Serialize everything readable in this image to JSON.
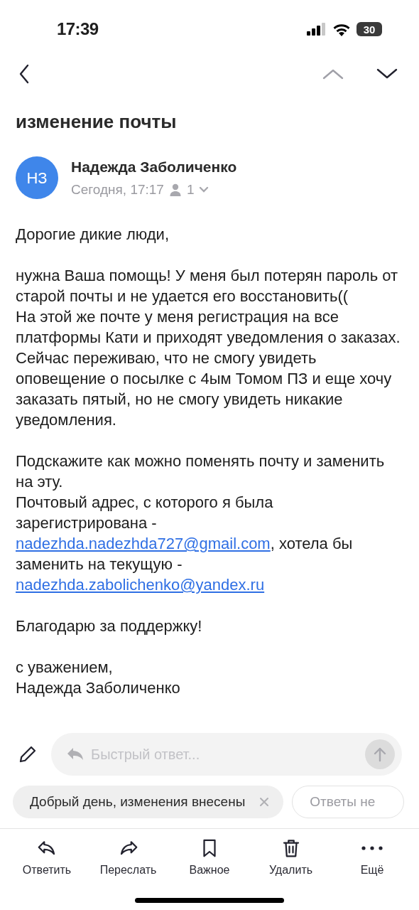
{
  "status_bar": {
    "time": "17:39",
    "battery": "30"
  },
  "subject": "изменение почты",
  "sender": {
    "initials": "НЗ",
    "name": "Надежда Заболиченко",
    "date": "Сегодня, 17:17",
    "recipients": "1"
  },
  "body": [
    [
      {
        "kind": "text",
        "text": "Дорогие дикие люди,"
      }
    ],
    [
      {
        "kind": "text",
        "text": "нужна Ваша помощь! У меня был потерян пароль от старой почты и не удается его восстановить((\nНа этой же почте у меня регистрация на все платформы Кати и приходят уведомления о заказах.\nСейчас переживаю, что не смогу увидеть оповещение о посылке с 4ым Томом ПЗ и еще хочу заказать пятый, но не смогу увидеть никакие уведомления."
      }
    ],
    [
      {
        "kind": "text",
        "text": "Подскажите как можно поменять почту и заменить на эту.\nПочтовый адрес, с которого я была зарегистрирована - "
      },
      {
        "kind": "link",
        "text": "nadezhda.nadezhda727@gmail.com"
      },
      {
        "kind": "text",
        "text": ", хотела бы заменить на текущую - "
      },
      {
        "kind": "link",
        "text": "nadezhda.zabolichenko@yandex.ru"
      }
    ],
    [
      {
        "kind": "text",
        "text": "Благодарю за поддержку!"
      }
    ],
    [
      {
        "kind": "text",
        "text": "с уважением,\nНадежда Заболиченко"
      }
    ]
  ],
  "quick_reply": {
    "placeholder": "Быстрый ответ..."
  },
  "suggestions": [
    "Добрый день, изменения внесены",
    "Ответы не"
  ],
  "toolbar": [
    {
      "kind": "reply",
      "label": "Ответить"
    },
    {
      "kind": "forward",
      "label": "Переслать"
    },
    {
      "kind": "bookmark",
      "label": "Важное"
    },
    {
      "kind": "delete",
      "label": "Удалить"
    },
    {
      "kind": "more",
      "label": "Ещё"
    }
  ]
}
